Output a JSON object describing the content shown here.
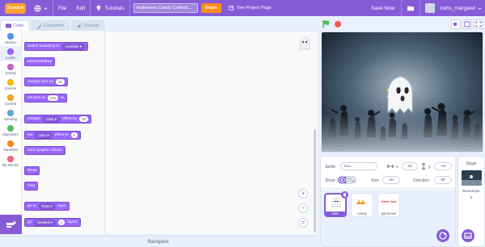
{
  "menubar": {
    "logo": "Scratch",
    "file": "File",
    "edit": "Edit",
    "tutorials": "Tutorials",
    "project_title": "Halloween Candy Collecto...",
    "share": "Share",
    "see_project_page": "See Project Page",
    "save_now": "Save Now",
    "username": "cwhs_margaret"
  },
  "tabs": {
    "code": "Code",
    "costumes": "Costumes",
    "sounds": "Sounds"
  },
  "categories": [
    {
      "label": "Motion",
      "color": "#4c97ff"
    },
    {
      "label": "Looks",
      "color": "#9966ff"
    },
    {
      "label": "Sound",
      "color": "#cf63cf"
    },
    {
      "label": "Events",
      "color": "#ffbf00"
    },
    {
      "label": "Control",
      "color": "#ffab19"
    },
    {
      "label": "Sensing",
      "color": "#5cb1d6"
    },
    {
      "label": "Operators",
      "color": "#59c059"
    },
    {
      "label": "Variables",
      "color": "#ff8c1a"
    },
    {
      "label": "My Blocks",
      "color": "#ff6680"
    }
  ],
  "blocks": {
    "switch_backdrop": "switch backdrop to",
    "switch_backdrop_value": "zombies",
    "next_backdrop": "next backdrop",
    "change_size": "change size by",
    "change_size_value": "10",
    "set_size": "set size to",
    "set_size_value": "100",
    "set_size_unit": "%",
    "change_effect": "change",
    "change_effect_dd": "color",
    "change_effect_by": "effect by",
    "change_effect_value": "25",
    "set_effect": "set",
    "set_effect_dd": "color",
    "set_effect_to": "effect to",
    "set_effect_value": "0",
    "clear_effects": "clear graphic effects",
    "show": "show",
    "hide": "hide",
    "go_to": "go to",
    "go_to_dd": "front",
    "go_to_layer": "layer",
    "go": "go",
    "go_dd": "forward",
    "go_value": "1",
    "go_layers": "layers"
  },
  "backpack": "Backpack",
  "sprite_info": {
    "sprite_label": "Sprite",
    "sprite_name": "boo",
    "x_label": "x",
    "x_value": "33",
    "y_label": "y",
    "y_value": "-24",
    "show_label": "Show",
    "size_label": "Size",
    "size_value": "30",
    "direction_label": "Direction",
    "direction_value": "90"
  },
  "sprites": [
    {
      "name": "boo",
      "selected": true
    },
    {
      "name": "candy",
      "selected": false
    },
    {
      "name": "gameover",
      "selected": false
    }
  ],
  "sprite_thumb_text": "Game Over",
  "stage_selector": {
    "title": "Stage",
    "backdrops_label": "Backdrops",
    "backdrops_count": "6"
  }
}
